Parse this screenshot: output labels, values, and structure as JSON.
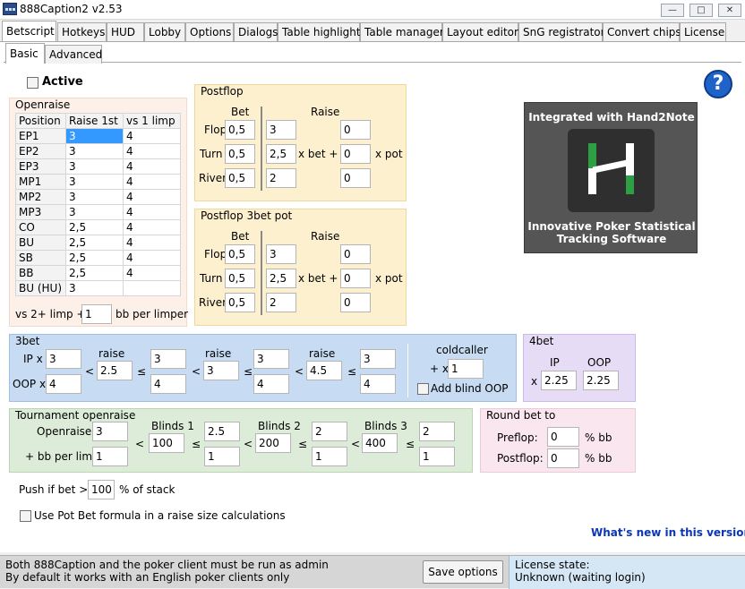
{
  "window": {
    "title": "888Caption2 v2.53"
  },
  "tabs": [
    "Betscript",
    "Hotkeys",
    "HUD",
    "Lobby",
    "Options",
    "Dialogs",
    "Table highlight",
    "Table manager",
    "Layout editor",
    "SnG registrator",
    "Convert chips",
    "License"
  ],
  "subtabs": [
    "Basic",
    "Advanced"
  ],
  "active_label": "Active",
  "openraise": {
    "title": "Openraise",
    "headers": [
      "Position",
      "Raise 1st",
      "vs 1 limp"
    ],
    "rows": [
      [
        "EP1",
        "3",
        "4"
      ],
      [
        "EP2",
        "3",
        "4"
      ],
      [
        "EP3",
        "3",
        "4"
      ],
      [
        "MP1",
        "3",
        "4"
      ],
      [
        "MP2",
        "3",
        "4"
      ],
      [
        "MP3",
        "3",
        "4"
      ],
      [
        "CO",
        "2,5",
        "4"
      ],
      [
        "BU",
        "2,5",
        "4"
      ],
      [
        "SB",
        "2,5",
        "4"
      ],
      [
        "BB",
        "2,5",
        "4"
      ],
      [
        "BU (HU)",
        "3",
        ""
      ]
    ],
    "limp_prefix": "vs 2+ limp +",
    "limp_value": "1",
    "limp_suffix": "bb per limper"
  },
  "postflop": {
    "title": "Postflop",
    "bet_header": "Bet",
    "raise_header": "Raise",
    "x_bet": "x bet +",
    "x_pot": "x pot",
    "rows": [
      {
        "street": "Flop",
        "bet": "0,5",
        "raise": "3",
        "pot": "0"
      },
      {
        "street": "Turn",
        "bet": "0,5",
        "raise": "2,5",
        "pot": "0"
      },
      {
        "street": "River",
        "bet": "0,5",
        "raise": "2",
        "pot": "0"
      }
    ]
  },
  "postflop3bet": {
    "title": "Postflop 3bet pot",
    "bet_header": "Bet",
    "raise_header": "Raise",
    "x_bet": "x bet +",
    "x_pot": "x pot",
    "rows": [
      {
        "street": "Flop",
        "bet": "0,5",
        "raise": "3",
        "pot": "0"
      },
      {
        "street": "Turn",
        "bet": "0,5",
        "raise": "2,5",
        "pot": "0"
      },
      {
        "street": "River",
        "bet": "0,5",
        "raise": "2",
        "pot": "0"
      }
    ]
  },
  "promo": {
    "line1": "Integrated with Hand2Note",
    "line2": "Innovative Poker Statistical",
    "line3": "Tracking Software"
  },
  "threebet": {
    "title": "3bet",
    "ip_label": "IP x",
    "oop_label": "OOP x",
    "ip": "3",
    "oop": "4",
    "raise_label": "raise",
    "lt": "<",
    "le": "≤",
    "groups": [
      {
        "raise": "2.5",
        "ip": "3",
        "oop": "4"
      },
      {
        "raise": "3",
        "ip": "3",
        "oop": "4"
      },
      {
        "raise": "4.5",
        "ip": "3",
        "oop": "4"
      }
    ],
    "coldcaller_label": "coldcaller",
    "coldcaller_prefix": "+ x",
    "coldcaller_value": "1",
    "add_blind_label": "Add blind OOP"
  },
  "fourbet": {
    "title": "4bet",
    "ip_label": "IP",
    "oop_label": "OOP",
    "x": "x",
    "ip": "2.25",
    "oop": "2.25"
  },
  "tournament": {
    "title": "Tournament openraise",
    "openraise_label": "Openraise",
    "openraise_value": "3",
    "perlimp_label": "+ bb per limp",
    "perlimp_value": "1",
    "lt": "<",
    "le": "≤",
    "blinds": [
      {
        "label": "Blinds 1",
        "level": "100",
        "value": "2.5",
        "limp": "1"
      },
      {
        "label": "Blinds 2",
        "level": "200",
        "value": "2",
        "limp": "1"
      },
      {
        "label": "Blinds 3",
        "level": "400",
        "value": "2",
        "limp": "1"
      }
    ]
  },
  "roundbet": {
    "title": "Round bet to",
    "preflop_label": "Preflop:",
    "preflop": "0",
    "postflop_label": "Postflop:",
    "postflop": "0",
    "unit": "% bb"
  },
  "push": {
    "prefix": "Push if bet >",
    "value": "100",
    "suffix": "% of stack"
  },
  "potbet_label": "Use Pot Bet formula in a raise size calculations",
  "whats_new": "What's new in this version",
  "footer": {
    "line1": "Both 888Caption and the poker client must be run as admin",
    "line2": "By default it works with an English poker clients only",
    "save": "Save options",
    "license_label": "License state:",
    "license_value": "Unknown (waiting login)"
  },
  "colors": {
    "postflop_bg": "#fdf0cf",
    "openraise_bg": "#fdf0e8",
    "threebet_bg": "#c7dcf3",
    "fourbet_bg": "#e7dcf6",
    "tourn_bg": "#dcecd9",
    "round_bg": "#f9e6ef",
    "link": "#0b36b5",
    "selected": "#3399ff"
  }
}
